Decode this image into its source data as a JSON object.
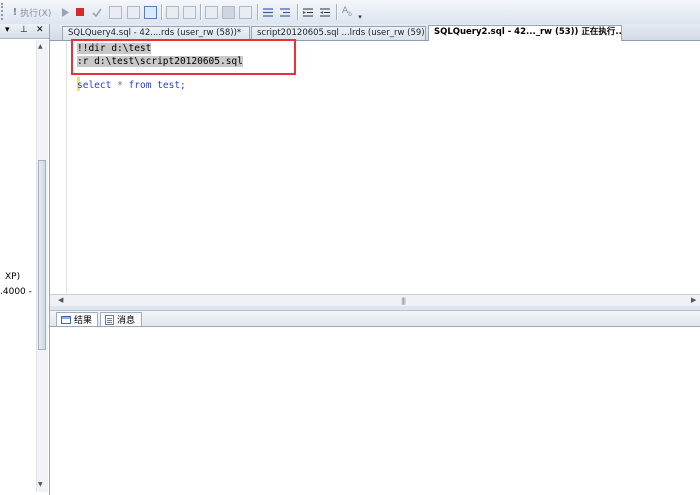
{
  "toolbar": {
    "execute_label": "执行(X)",
    "buttons": [
      "stop-icon",
      "check-icon",
      "parse-icon",
      "estimated-plan-icon",
      "query-options-icon",
      "intellisense-icon",
      "include-plan-icon",
      "results-text-icon",
      "results-grid-icon",
      "results-file-icon",
      "comment-icon",
      "uncomment-icon",
      "outdent-icon",
      "indent-icon",
      "specify-values-icon"
    ]
  },
  "left_panel": {
    "header_pin": "▾ ⊥ ✕",
    "text_line1": "XP)",
    "text_line2": ".4000 -"
  },
  "tabs": [
    {
      "label": "SQLQuery4.sql - 42....rds (user_rw (58))*",
      "active": false
    },
    {
      "label": "script20120605.sql ...lrds (user_rw (59))",
      "active": false
    },
    {
      "label": "SQLQuery2.sql - 42..._rw (53)) 正在执行...*",
      "active": true
    }
  ],
  "editor": {
    "lines": [
      {
        "text": "!!dir d:\\test",
        "selected": true
      },
      {
        "text": ":r d:\\test\\script20120605.sql",
        "selected": true
      }
    ],
    "query": {
      "kw1": "select",
      "star": "*",
      "kw2": "from",
      "rest": "test;"
    }
  },
  "results_tabs": [
    {
      "label": "结果",
      "icon": "grid-icon",
      "active": true
    },
    {
      "label": "消息",
      "icon": "message-icon",
      "active": false
    }
  ],
  "colors": {
    "highlight_box": "#e8313a",
    "keyword": "#2c3fcf",
    "selection": "#c9c9c9"
  }
}
